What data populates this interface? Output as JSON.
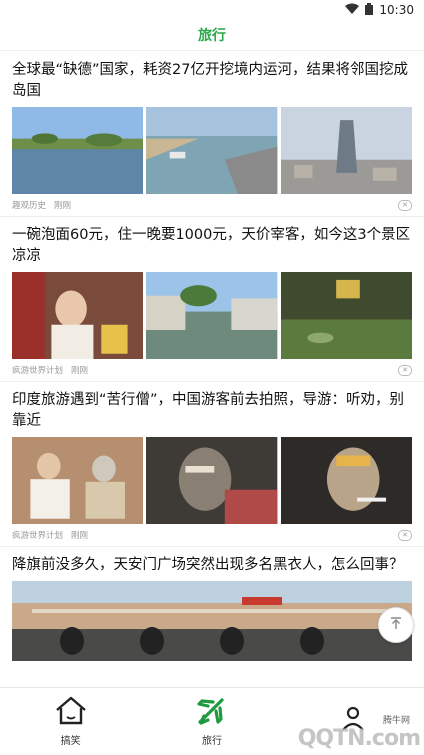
{
  "status": {
    "time": "10:30"
  },
  "header": {
    "title": "旅行"
  },
  "articles": [
    {
      "headline": "全球最“缺德”国家，耗资27亿开挖境内运河，结果将邻国挖成岛国",
      "source": "趣观历史",
      "time": "刚刚"
    },
    {
      "headline": "一碗泡面60元，住一晚要1000元，天价宰客，如今这3个景区凉凉",
      "source": "疯游世界计划",
      "time": "刚刚"
    },
    {
      "headline": "印度旅游遇到“苦行僧”，中国游客前去拍照，导游：听劝，别靠近",
      "source": "疯游世界计划",
      "time": "刚刚"
    },
    {
      "headline": "降旗前没多久，天安门广场突然出现多名黑衣人，怎么回事？"
    }
  ],
  "tabs": [
    {
      "label": "搞笑",
      "icon": "home-icon",
      "active": false
    },
    {
      "label": "旅行",
      "icon": "airplane-icon",
      "active": true
    },
    {
      "label": "",
      "icon": "person-icon",
      "active": false
    }
  ],
  "watermark": {
    "site": "腾牛网",
    "logo": "QQTN.com"
  },
  "colors": {
    "accent": "#2aa84a"
  }
}
